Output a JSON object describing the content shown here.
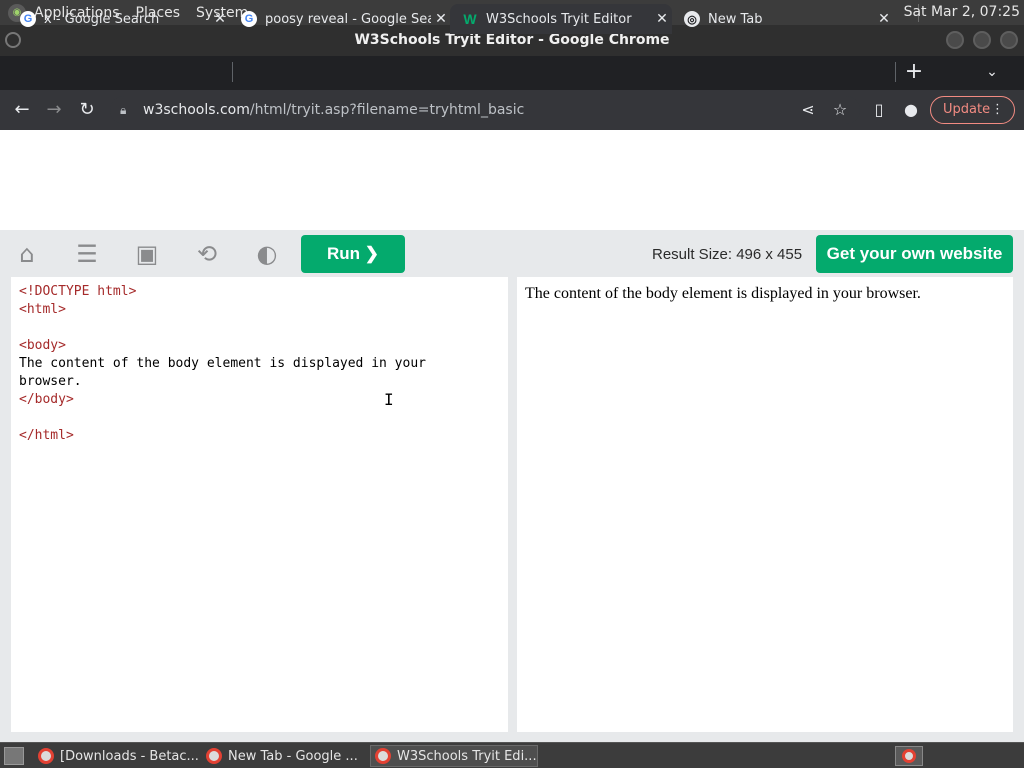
{
  "top_panel": {
    "menus": [
      "Applications",
      "Places",
      "System"
    ],
    "clock": "Sat Mar  2, 07:25"
  },
  "window": {
    "title": "W3Schools Tryit Editor - Google Chrome"
  },
  "tabs": [
    {
      "title": "x - Google Search",
      "icon": "google-icon"
    },
    {
      "title": "poosy reveal - Google Sear",
      "icon": "google-icon"
    },
    {
      "title": "W3Schools Tryit Editor",
      "icon": "w3schools-icon",
      "active": true
    },
    {
      "title": "New Tab",
      "icon": "chrome-icon"
    }
  ],
  "toolbar": {
    "url_host": "w3schools.com",
    "url_path": "/html/tryit.asp?filename=tryhtml_basic",
    "update_label": "Update"
  },
  "tryit": {
    "run_label": "Run ❯",
    "result_size": "Result Size: 496 x 455",
    "get_website_label": "Get your own website",
    "code_lines": [
      "<!DOCTYPE html>",
      "<html>",
      "",
      "<body>",
      "The content of the body element is displayed in your",
      "browser.",
      "</body>",
      "",
      "</html>"
    ],
    "result_text": "The content of the body element is displayed in your browser."
  },
  "taskbar": {
    "items": [
      {
        "label": "[Downloads - Betac..."
      },
      {
        "label": "New Tab - Google ..."
      },
      {
        "label": "W3Schools Tryit Edi...",
        "active": true
      }
    ]
  },
  "colors": {
    "accent_green": "#04aa6d",
    "tag_color": "#a52a2a",
    "update_color": "#f28b82"
  }
}
